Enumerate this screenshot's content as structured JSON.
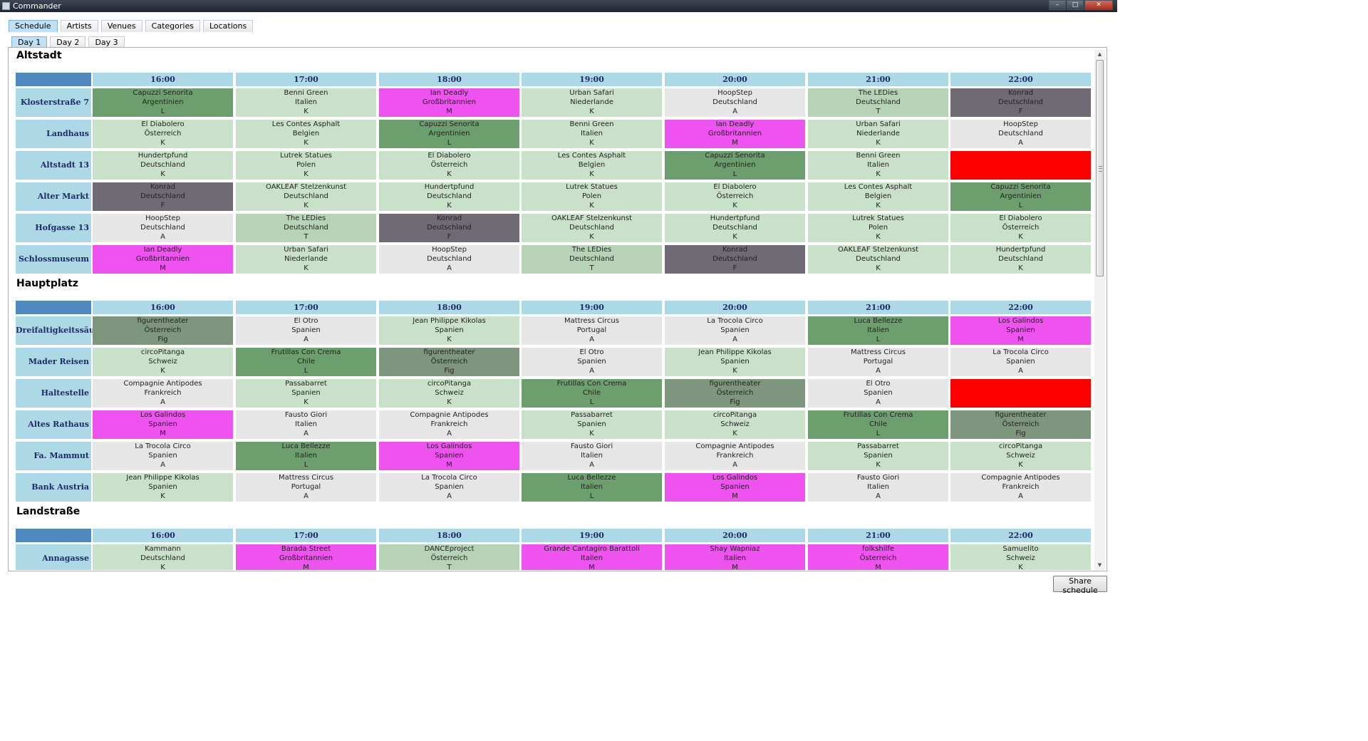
{
  "window": {
    "title": "Commander"
  },
  "main_tabs": [
    "Schedule",
    "Artists",
    "Venues",
    "Categories",
    "Locations"
  ],
  "day_tabs": [
    "Day 1",
    "Day 2",
    "Day 3"
  ],
  "share_button": "Share schedule",
  "time_slots": [
    "16:00",
    "17:00",
    "18:00",
    "19:00",
    "20:00",
    "21:00",
    "22:00"
  ],
  "colors": {
    "K": "#c9e1c9",
    "L": "#6d9e6d",
    "M": "#ef53ef",
    "F": "#6f6a73",
    "A": "#e6e6e6",
    "T": "#b6d3b6",
    "Fig": "#7d967d",
    "empty": "#ff0000",
    "header_corner": "#4e8ac0",
    "header": "#add8e6"
  },
  "schedule": [
    {
      "location": "Altstadt",
      "venues": [
        {
          "name": "Klosterstraße 7",
          "slots": [
            {
              "artist": "Capuzzi Senorita",
              "country": "Argentinien",
              "category": "L"
            },
            {
              "artist": "Benni Green",
              "country": "Italien",
              "category": "K"
            },
            {
              "artist": "Ian Deadly",
              "country": "Großbritannien",
              "category": "M"
            },
            {
              "artist": "Urban Safari",
              "country": "Niederlande",
              "category": "K"
            },
            {
              "artist": "HoopStep",
              "country": "Deutschland",
              "category": "A"
            },
            {
              "artist": "The LEDies",
              "country": "Deutschland",
              "category": "T"
            },
            {
              "artist": "Konrad",
              "country": "Deutschland",
              "category": "F"
            }
          ]
        },
        {
          "name": "Landhaus",
          "slots": [
            {
              "artist": "El Diabolero",
              "country": "Österreich",
              "category": "K"
            },
            {
              "artist": "Les Contes Asphalt",
              "country": "Belgien",
              "category": "K"
            },
            {
              "artist": "Capuzzi Senorita",
              "country": "Argentinien",
              "category": "L"
            },
            {
              "artist": "Benni Green",
              "country": "Italien",
              "category": "K"
            },
            {
              "artist": "Ian Deadly",
              "country": "Großbritannien",
              "category": "M"
            },
            {
              "artist": "Urban Safari",
              "country": "Niederlande",
              "category": "K"
            },
            {
              "artist": "HoopStep",
              "country": "Deutschland",
              "category": "A"
            }
          ]
        },
        {
          "name": "Altstadt 13",
          "slots": [
            {
              "artist": "Hundertpfund",
              "country": "Deutschland",
              "category": "K"
            },
            {
              "artist": "Lutrek Statues",
              "country": "Polen",
              "category": "K"
            },
            {
              "artist": "El Diabolero",
              "country": "Österreich",
              "category": "K"
            },
            {
              "artist": "Les Contes Asphalt",
              "country": "Belgien",
              "category": "K"
            },
            {
              "artist": "Capuzzi Senorita",
              "country": "Argentinien",
              "category": "L"
            },
            {
              "artist": "Benni Green",
              "country": "Italien",
              "category": "K"
            },
            null
          ]
        },
        {
          "name": "Alter Markt",
          "slots": [
            {
              "artist": "Konrad",
              "country": "Deutschland",
              "category": "F"
            },
            {
              "artist": "OAKLEAF Stelzenkunst",
              "country": "Deutschland",
              "category": "K"
            },
            {
              "artist": "Hundertpfund",
              "country": "Deutschland",
              "category": "K"
            },
            {
              "artist": "Lutrek Statues",
              "country": "Polen",
              "category": "K"
            },
            {
              "artist": "El Diabolero",
              "country": "Österreich",
              "category": "K"
            },
            {
              "artist": "Les Contes Asphalt",
              "country": "Belgien",
              "category": "K"
            },
            {
              "artist": "Capuzzi Senorita",
              "country": "Argentinien",
              "category": "L"
            }
          ]
        },
        {
          "name": "Hofgasse 13",
          "slots": [
            {
              "artist": "HoopStep",
              "country": "Deutschland",
              "category": "A"
            },
            {
              "artist": "The LEDies",
              "country": "Deutschland",
              "category": "T"
            },
            {
              "artist": "Konrad",
              "country": "Deutschland",
              "category": "F"
            },
            {
              "artist": "OAKLEAF Stelzenkunst",
              "country": "Deutschland",
              "category": "K"
            },
            {
              "artist": "Hundertpfund",
              "country": "Deutschland",
              "category": "K"
            },
            {
              "artist": "Lutrek Statues",
              "country": "Polen",
              "category": "K"
            },
            {
              "artist": "El Diabolero",
              "country": "Österreich",
              "category": "K"
            }
          ]
        },
        {
          "name": "Schlossmuseum",
          "slots": [
            {
              "artist": "Ian Deadly",
              "country": "Großbritannien",
              "category": "M"
            },
            {
              "artist": "Urban Safari",
              "country": "Niederlande",
              "category": "K"
            },
            {
              "artist": "HoopStep",
              "country": "Deutschland",
              "category": "A"
            },
            {
              "artist": "The LEDies",
              "country": "Deutschland",
              "category": "T"
            },
            {
              "artist": "Konrad",
              "country": "Deutschland",
              "category": "F"
            },
            {
              "artist": "OAKLEAF Stelzenkunst",
              "country": "Deutschland",
              "category": "K"
            },
            {
              "artist": "Hundertpfund",
              "country": "Deutschland",
              "category": "K"
            }
          ]
        }
      ]
    },
    {
      "location": "Hauptplatz",
      "venues": [
        {
          "name": "Dreifaltigkeitssäule",
          "slots": [
            {
              "artist": "figurentheater",
              "country": "Österreich",
              "category": "Fig"
            },
            {
              "artist": "El Otro",
              "country": "Spanien",
              "category": "A"
            },
            {
              "artist": "Jean Philippe Kikolas",
              "country": "Spanien",
              "category": "K"
            },
            {
              "artist": "Mattress Circus",
              "country": "Portugal",
              "category": "A"
            },
            {
              "artist": "La Trocola Circo",
              "country": "Spanien",
              "category": "A"
            },
            {
              "artist": "Luca Bellezze",
              "country": "Italien",
              "category": "L"
            },
            {
              "artist": "Los Galindos",
              "country": "Spanien",
              "category": "M"
            }
          ]
        },
        {
          "name": "Mader Reisen",
          "slots": [
            {
              "artist": "circoPitanga",
              "country": "Schweiz",
              "category": "K"
            },
            {
              "artist": "Frutillas Con Crema",
              "country": "Chile",
              "category": "L"
            },
            {
              "artist": "figurentheater",
              "country": "Österreich",
              "category": "Fig"
            },
            {
              "artist": "El Otro",
              "country": "Spanien",
              "category": "A"
            },
            {
              "artist": "Jean Philippe Kikolas",
              "country": "Spanien",
              "category": "K"
            },
            {
              "artist": "Mattress Circus",
              "country": "Portugal",
              "category": "A"
            },
            {
              "artist": "La Trocola Circo",
              "country": "Spanien",
              "category": "A"
            }
          ]
        },
        {
          "name": "Haltestelle",
          "slots": [
            {
              "artist": "Compagnie Antipodes",
              "country": "Frankreich",
              "category": "A"
            },
            {
              "artist": "Passabarret",
              "country": "Spanien",
              "category": "K"
            },
            {
              "artist": "circoPitanga",
              "country": "Schweiz",
              "category": "K"
            },
            {
              "artist": "Frutillas Con Crema",
              "country": "Chile",
              "category": "L"
            },
            {
              "artist": "figurentheater",
              "country": "Österreich",
              "category": "Fig"
            },
            {
              "artist": "El Otro",
              "country": "Spanien",
              "category": "A"
            },
            null
          ]
        },
        {
          "name": "Altes Rathaus",
          "slots": [
            {
              "artist": "Los Galindos",
              "country": "Spanien",
              "category": "M"
            },
            {
              "artist": "Fausto Giori",
              "country": "Italien",
              "category": "A"
            },
            {
              "artist": "Compagnie Antipodes",
              "country": "Frankreich",
              "category": "A"
            },
            {
              "artist": "Passabarret",
              "country": "Spanien",
              "category": "K"
            },
            {
              "artist": "circoPitanga",
              "country": "Schweiz",
              "category": "K"
            },
            {
              "artist": "Frutillas Con Crema",
              "country": "Chile",
              "category": "L"
            },
            {
              "artist": "figurentheater",
              "country": "Österreich",
              "category": "Fig"
            }
          ]
        },
        {
          "name": "Fa. Mammut",
          "slots": [
            {
              "artist": "La Trocola Circo",
              "country": "Spanien",
              "category": "A"
            },
            {
              "artist": "Luca Bellezze",
              "country": "Italien",
              "category": "L"
            },
            {
              "artist": "Los Galindos",
              "country": "Spanien",
              "category": "M"
            },
            {
              "artist": "Fausto Giori",
              "country": "Italien",
              "category": "A"
            },
            {
              "artist": "Compagnie Antipodes",
              "country": "Frankreich",
              "category": "A"
            },
            {
              "artist": "Passabarret",
              "country": "Spanien",
              "category": "K"
            },
            {
              "artist": "circoPitanga",
              "country": "Schweiz",
              "category": "K"
            }
          ]
        },
        {
          "name": "Bank Austria",
          "slots": [
            {
              "artist": "Jean Philippe Kikolas",
              "country": "Spanien",
              "category": "K"
            },
            {
              "artist": "Mattress Circus",
              "country": "Portugal",
              "category": "A"
            },
            {
              "artist": "La Trocola Circo",
              "country": "Spanien",
              "category": "A"
            },
            {
              "artist": "Luca Bellezze",
              "country": "Italien",
              "category": "L"
            },
            {
              "artist": "Los Galindos",
              "country": "Spanien",
              "category": "M"
            },
            {
              "artist": "Fausto Giori",
              "country": "Italien",
              "category": "A"
            },
            {
              "artist": "Compagnie Antipodes",
              "country": "Frankreich",
              "category": "A"
            }
          ]
        }
      ]
    },
    {
      "location": "Landstraße",
      "venues": [
        {
          "name": "Annagasse",
          "slots": [
            {
              "artist": "Kammann",
              "country": "Deutschland",
              "category": "K"
            },
            {
              "artist": "Barada Street",
              "country": "Großbritannien",
              "category": "M"
            },
            {
              "artist": "DANCEproject",
              "country": "Österreich",
              "category": "T"
            },
            {
              "artist": "Grande Cantagiro Barattoli",
              "country": "Italien",
              "category": "M"
            },
            {
              "artist": "Shay Wapniaz",
              "country": "Italien",
              "category": "M"
            },
            {
              "artist": "folkshilfe",
              "country": "Österreich",
              "category": "M"
            },
            {
              "artist": "Samuelito",
              "country": "Schweiz",
              "category": "K"
            }
          ]
        }
      ]
    }
  ]
}
